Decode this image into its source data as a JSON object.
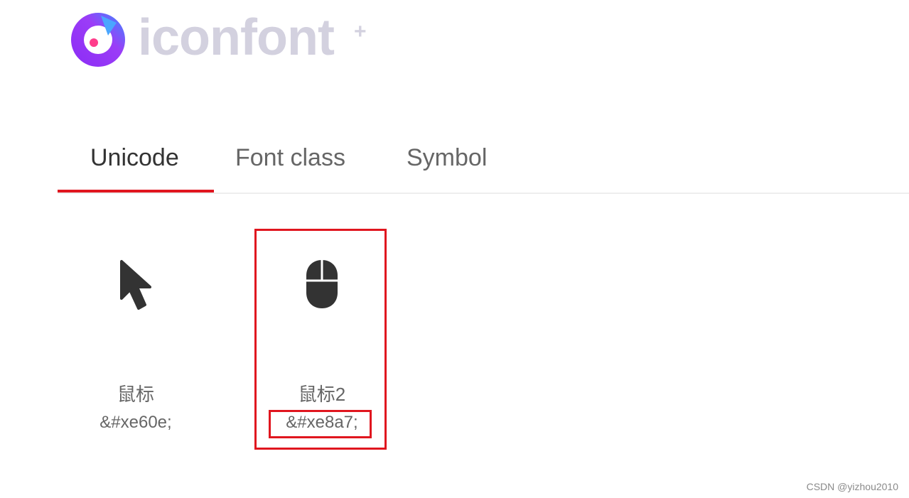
{
  "logo": {
    "text": "iconfont",
    "plus": "+",
    "icon": "iconfont-logo-icon"
  },
  "tabs": [
    {
      "label": "Unicode",
      "active": true
    },
    {
      "label": "Font class",
      "active": false
    },
    {
      "label": "Symbol",
      "active": false
    }
  ],
  "icons": [
    {
      "name": "鼠标",
      "code": "&#xe60e;",
      "icon": "cursor-arrow-icon",
      "highlighted": false
    },
    {
      "name": "鼠标2",
      "code": "&#xe8a7;",
      "icon": "mouse-icon",
      "highlighted": true
    }
  ],
  "colors": {
    "accent": "#e0161f",
    "logo_text": "#d3d1df",
    "icon": "#333333",
    "text": "#666666"
  },
  "watermark": "CSDN @yizhou2010"
}
